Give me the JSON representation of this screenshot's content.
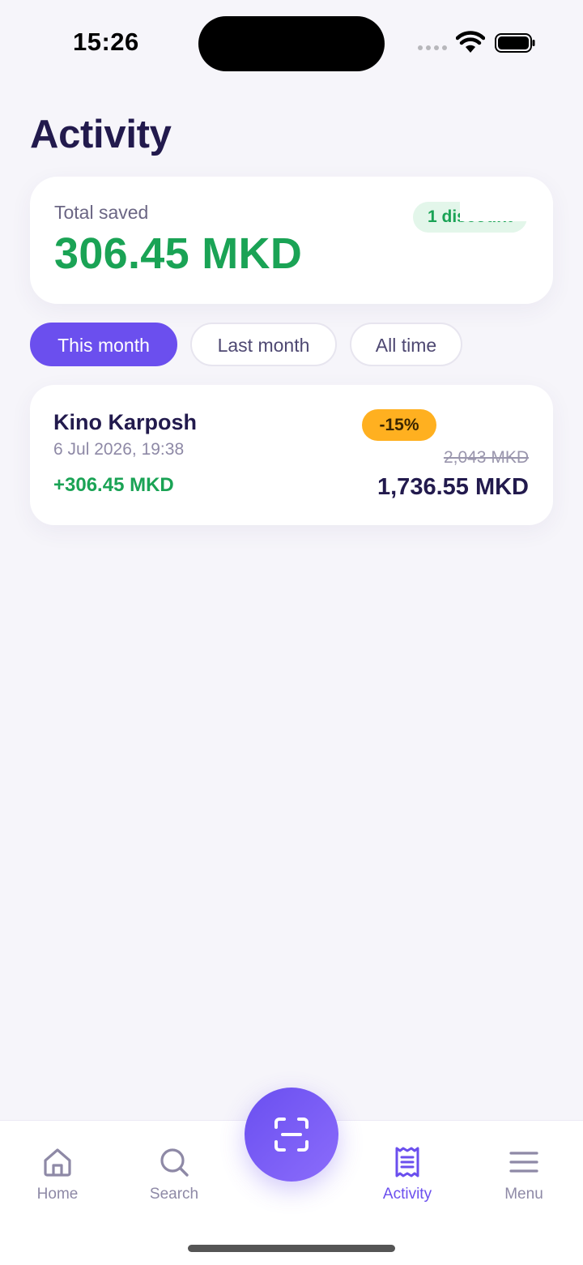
{
  "status_bar": {
    "time": "15:26"
  },
  "page": {
    "title": "Activity"
  },
  "savings": {
    "label": "Total saved",
    "value": "306.45 MKD",
    "badge": "1 discount"
  },
  "filters": [
    {
      "label": "This month",
      "active": true
    },
    {
      "label": "Last month",
      "active": false
    },
    {
      "label": "All time",
      "active": false
    }
  ],
  "transactions": [
    {
      "name": "Kino Karposh",
      "date": "6 Jul 2026, 19:38",
      "saved": "+306.45 MKD",
      "discount": "-15%",
      "original": "2,043 MKD",
      "final": "1,736.55 MKD"
    }
  ],
  "nav": {
    "home": "Home",
    "search": "Search",
    "activity": "Activity",
    "menu": "Menu"
  },
  "colors": {
    "accent": "#6b4fee",
    "success": "#1aa355",
    "discount_badge": "#ffb020",
    "text_primary": "#221a4d",
    "background": "#f6f5fa"
  }
}
